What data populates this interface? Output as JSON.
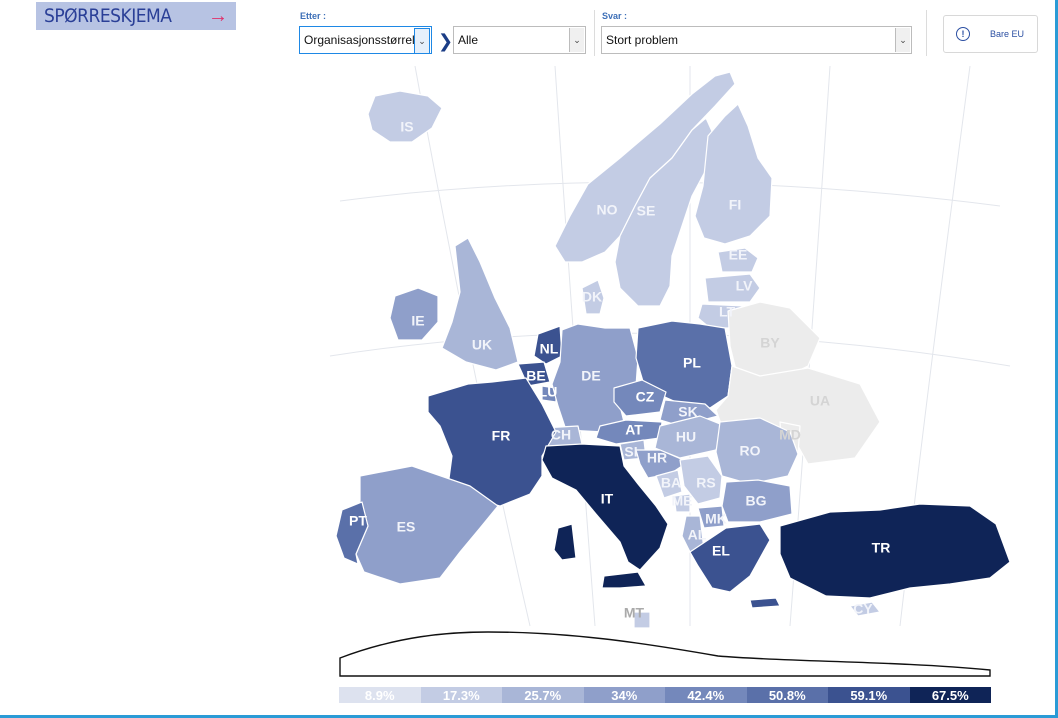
{
  "survey_button": {
    "label": "SPØRRESKJEMA",
    "arrow": "→"
  },
  "filters": {
    "by_label": "Etter :",
    "by_value": "Organisasjonsstørrelse",
    "sub_value": "Alle",
    "answer_label": "Svar :",
    "answer_value": "Stort problem"
  },
  "eu_only": {
    "label": "Bare EU",
    "icon": "info-icon"
  },
  "colors": {
    "accent": "#2a9bd6",
    "no_data": "#ececec",
    "scale": [
      "#dde2ef",
      "#c3cce4",
      "#a9b6d7",
      "#8f9fca",
      "#7488bb",
      "#5a70a9",
      "#3b5290",
      "#0f2457"
    ]
  },
  "map": {
    "countries": [
      {
        "code": "IS",
        "level": 1
      },
      {
        "code": "NO",
        "level": 1
      },
      {
        "code": "SE",
        "level": 1
      },
      {
        "code": "FI",
        "level": 1
      },
      {
        "code": "EE",
        "level": 1
      },
      {
        "code": "LV",
        "level": 1
      },
      {
        "code": "LT",
        "level": 1
      },
      {
        "code": "DK",
        "level": 1
      },
      {
        "code": "IE",
        "level": 3
      },
      {
        "code": "UK",
        "level": 2
      },
      {
        "code": "NL",
        "level": 6
      },
      {
        "code": "BE",
        "level": 6
      },
      {
        "code": "LU",
        "level": 4
      },
      {
        "code": "DE",
        "level": 3
      },
      {
        "code": "PL",
        "level": 5
      },
      {
        "code": "BY",
        "level": null
      },
      {
        "code": "UA",
        "level": null
      },
      {
        "code": "MD",
        "level": null
      },
      {
        "code": "CZ",
        "level": 4
      },
      {
        "code": "SK",
        "level": 3
      },
      {
        "code": "AT",
        "level": 4
      },
      {
        "code": "CH",
        "level": 2
      },
      {
        "code": "HU",
        "level": 2
      },
      {
        "code": "SI",
        "level": 2
      },
      {
        "code": "HR",
        "level": 3
      },
      {
        "code": "RO",
        "level": 2
      },
      {
        "code": "RS",
        "level": 1
      },
      {
        "code": "BA",
        "level": 1
      },
      {
        "code": "ME",
        "level": 1
      },
      {
        "code": "MK",
        "level": 3
      },
      {
        "code": "AL",
        "level": 2
      },
      {
        "code": "BG",
        "level": 3
      },
      {
        "code": "EL",
        "level": 6
      },
      {
        "code": "TR",
        "level": 7
      },
      {
        "code": "FR",
        "level": 6
      },
      {
        "code": "ES",
        "level": 3
      },
      {
        "code": "PT",
        "level": 5
      },
      {
        "code": "IT",
        "level": 7
      },
      {
        "code": "CY",
        "level": 1
      },
      {
        "code": "MT",
        "level": 1
      }
    ]
  },
  "legend": {
    "ticks": [
      "8.9%",
      "17.3%",
      "25.7%",
      "34%",
      "42.4%",
      "50.8%",
      "59.1%",
      "67.5%"
    ]
  }
}
